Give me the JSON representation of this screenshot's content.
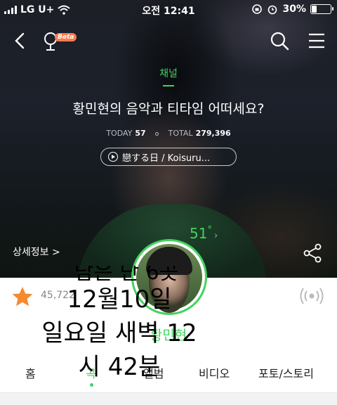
{
  "status_bar": {
    "carrier": "LG U+",
    "time": "오전 12:41",
    "battery": "30%",
    "battery_level": 0.3
  },
  "nav": {
    "beta_badge": "Beta",
    "icons": [
      "back-arrow-icon",
      "mic-icon",
      "search-icon",
      "menu-icon"
    ]
  },
  "hero": {
    "channel_label": "채널",
    "title": "황민현의 음악과 티타임 어떠세요?",
    "today_label": "TODAY",
    "today_value": "57",
    "total_label": "TOTAL",
    "total_value": "279,396",
    "song": "戀する日 / Koisuru...",
    "detail_link": "상세정보 >",
    "temperature": "51",
    "temperature_unit": "°"
  },
  "profile": {
    "likes": "45,722",
    "artist_name": "황민현"
  },
  "overlay": {
    "line0": "담은 단 6곳",
    "line1": "12월10일",
    "line2": "일요일 새벽 12",
    "line3": "시 42분"
  },
  "tabs": [
    {
      "label": "홈",
      "active": false
    },
    {
      "label": "곡",
      "active": true
    },
    {
      "label": "앨범",
      "active": false
    },
    {
      "label": "비디오",
      "active": false
    },
    {
      "label": "포토/스토리",
      "active": false
    }
  ],
  "colors": {
    "accent": "#43d35e",
    "star": "#f58a2e",
    "beta": "#ff7a4d"
  }
}
